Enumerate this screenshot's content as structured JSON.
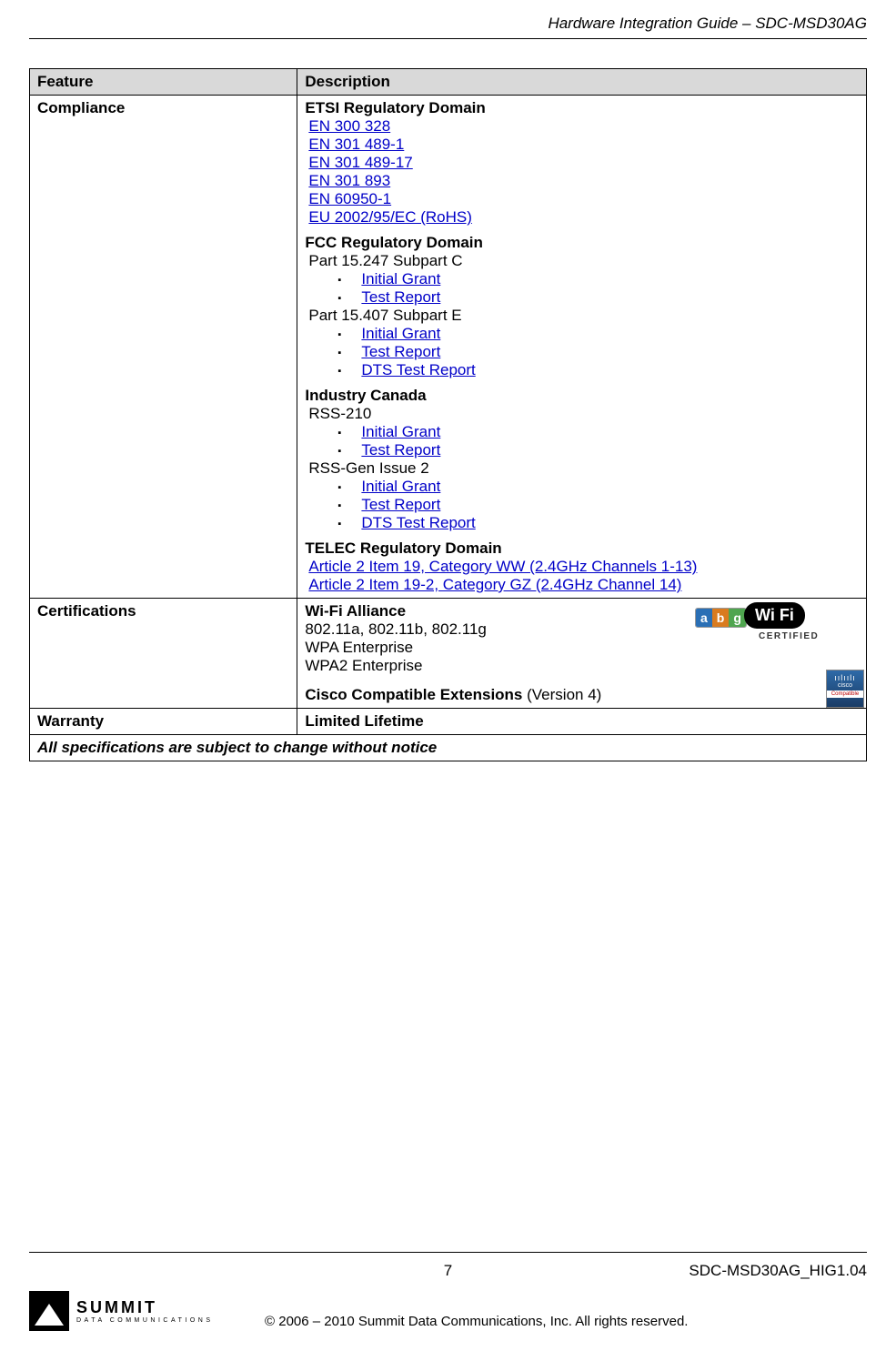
{
  "header": {
    "title": "Hardware Integration Guide – SDC-MSD30AG"
  },
  "table": {
    "head": {
      "feature": "Feature",
      "description": "Description"
    },
    "rows": {
      "compliance": {
        "feature": "Compliance",
        "etsi": {
          "heading": "ETSI Regulatory Domain",
          "links": [
            "EN 300 328",
            "EN 301 489-1",
            "EN 301 489-17",
            "EN 301 893",
            "EN 60950-1",
            "EU 2002/95/EC (RoHS)"
          ]
        },
        "fcc": {
          "heading": "FCC Regulatory Domain",
          "partC": {
            "label": "Part 15.247 Subpart C",
            "items": [
              "Initial Grant",
              "Test Report"
            ]
          },
          "partE": {
            "label": "Part 15.407 Subpart E",
            "items": [
              "Initial Grant",
              "Test Report",
              "DTS Test Report"
            ]
          }
        },
        "ic": {
          "heading": "Industry Canada",
          "rss210": {
            "label": "RSS-210",
            "items": [
              "Initial Grant",
              "Test Report"
            ]
          },
          "rssgen": {
            "label": "RSS-Gen Issue 2",
            "items": [
              "Initial Grant",
              "Test Report",
              "DTS Test Report"
            ]
          }
        },
        "telec": {
          "heading": "TELEC Regulatory Domain",
          "links": [
            "Article 2 Item 19, Category WW (2.4GHz Channels 1-13)",
            "Article  2 Item 19-2, Category GZ (2.4GHz Channel 14)"
          ]
        }
      },
      "certifications": {
        "feature": "Certifications",
        "wifi_heading": "Wi-Fi Alliance",
        "wifi_lines": [
          "802.11a, 802.11b, 802.11g",
          "WPA Enterprise",
          "WPA2 Enterprise"
        ],
        "cisco_bold": "Cisco Compatible Extensions",
        "cisco_rest": " (Version 4)"
      },
      "warranty": {
        "feature": "Warranty",
        "value": "Limited Lifetime"
      },
      "notice": "All specifications are subject to change without notice"
    }
  },
  "footer": {
    "page_num": "7",
    "doc_id": "SDC-MSD30AG_HIG1.04",
    "logo_big": "SUMMIT",
    "logo_small": "DATA  COMMUNICATIONS",
    "copyright": "© 2006 – 2010 Summit Data Communications, Inc. All rights reserved."
  },
  "badges": {
    "wifi_certified": "CERTIFIED",
    "cisco_name": "cisco",
    "cisco_compat": "Compatible"
  }
}
